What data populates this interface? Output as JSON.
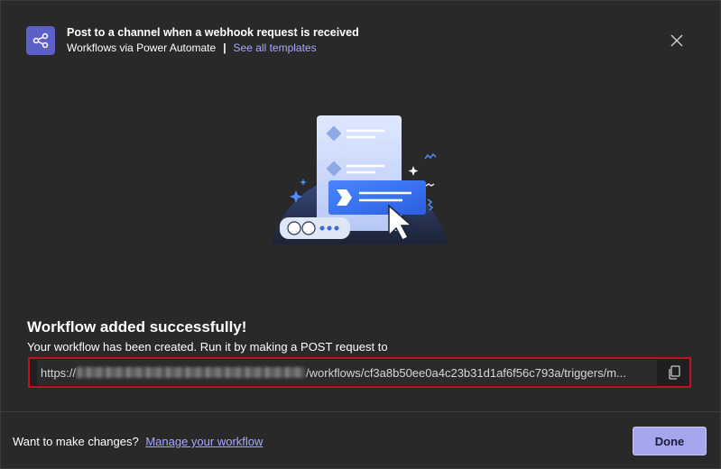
{
  "header": {
    "title": "Post to a channel when a webhook request is received",
    "subtitle": "Workflows via Power Automate",
    "separator": "|",
    "templates_link": "See all templates",
    "icon": "workflow-share-icon"
  },
  "content": {
    "success_title": "Workflow added successfully!",
    "success_desc": "Your workflow has been created. Run it by making a POST request to",
    "url_prefix": "https://",
    "url_suffix": "/workflows/cf3a8b50ee0a4c23b31d1af6f56c793a/triggers/m..."
  },
  "footer": {
    "prompt": "Want to make changes?",
    "manage_link": "Manage your workflow",
    "done_label": "Done"
  },
  "colors": {
    "background": "#292929",
    "accent": "#5b5fc7",
    "link": "#a7a9ff",
    "highlight_border": "#c50f1f",
    "done_button": "#a5a6ee"
  }
}
